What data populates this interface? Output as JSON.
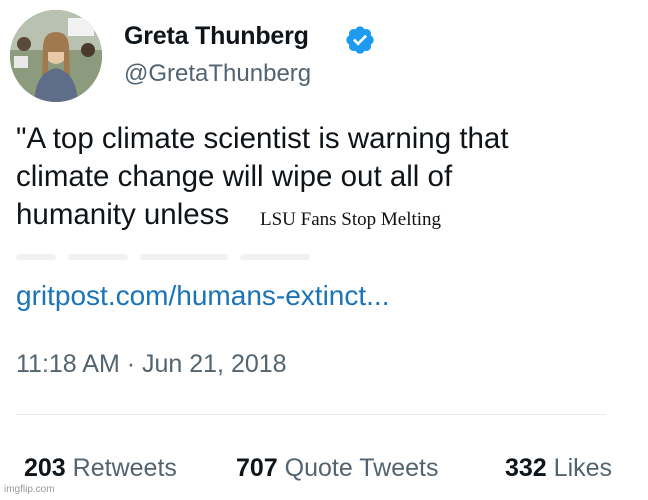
{
  "author": {
    "display_name": "Greta Thunberg",
    "handle": "@GretaThunberg",
    "avatar_icon": "profile-photo",
    "verified_icon": "verified-badge-icon",
    "verified_color": "#1d9bf0"
  },
  "tweet": {
    "lines": [
      "\"A top climate scientist is warning that",
      "climate change will wipe out all of",
      "humanity unless"
    ],
    "overlay_caption": "LSU Fans Stop Melting",
    "link": "gritpost.com/humans-extinct...",
    "timestamp": "11:18 AM · Jun 21, 2018"
  },
  "stats": {
    "retweets_count": "203",
    "retweets_label": "Retweets",
    "quotes_count": "707",
    "quotes_label": "Quote Tweets",
    "likes_count": "332",
    "likes_label": "Likes"
  },
  "watermark": "imgflip.com",
  "colors": {
    "text": "#0f1419",
    "secondary": "#536471",
    "link": "#1b74b7"
  }
}
